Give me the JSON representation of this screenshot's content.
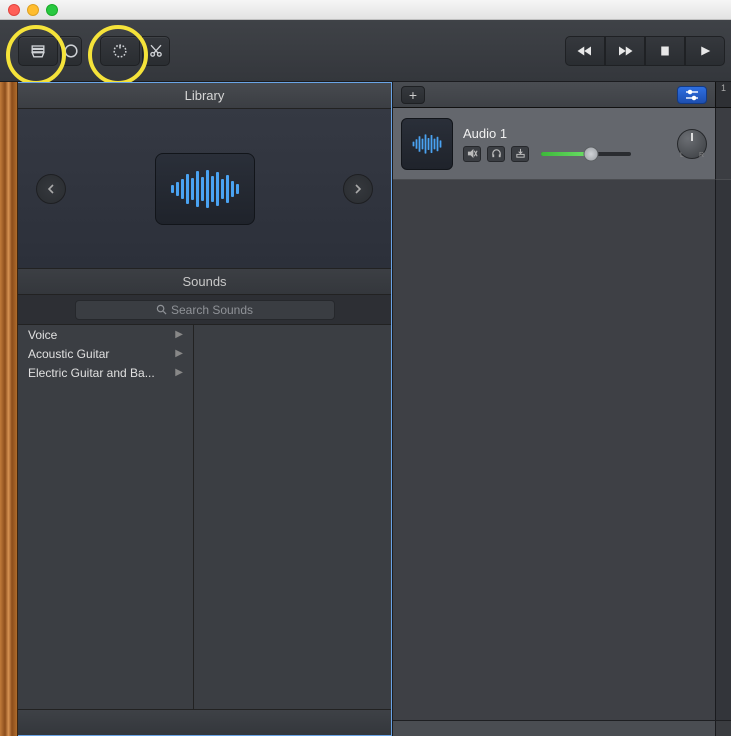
{
  "library": {
    "title": "Library",
    "sounds_header": "Sounds",
    "search_placeholder": "Search Sounds",
    "categories": [
      "Voice",
      "Acoustic Guitar",
      "Electric Guitar and Ba..."
    ]
  },
  "tracks": {
    "ruler_start": "1",
    "track1": {
      "name": "Audio 1"
    }
  },
  "pan": {
    "l": "L",
    "r": "R"
  }
}
